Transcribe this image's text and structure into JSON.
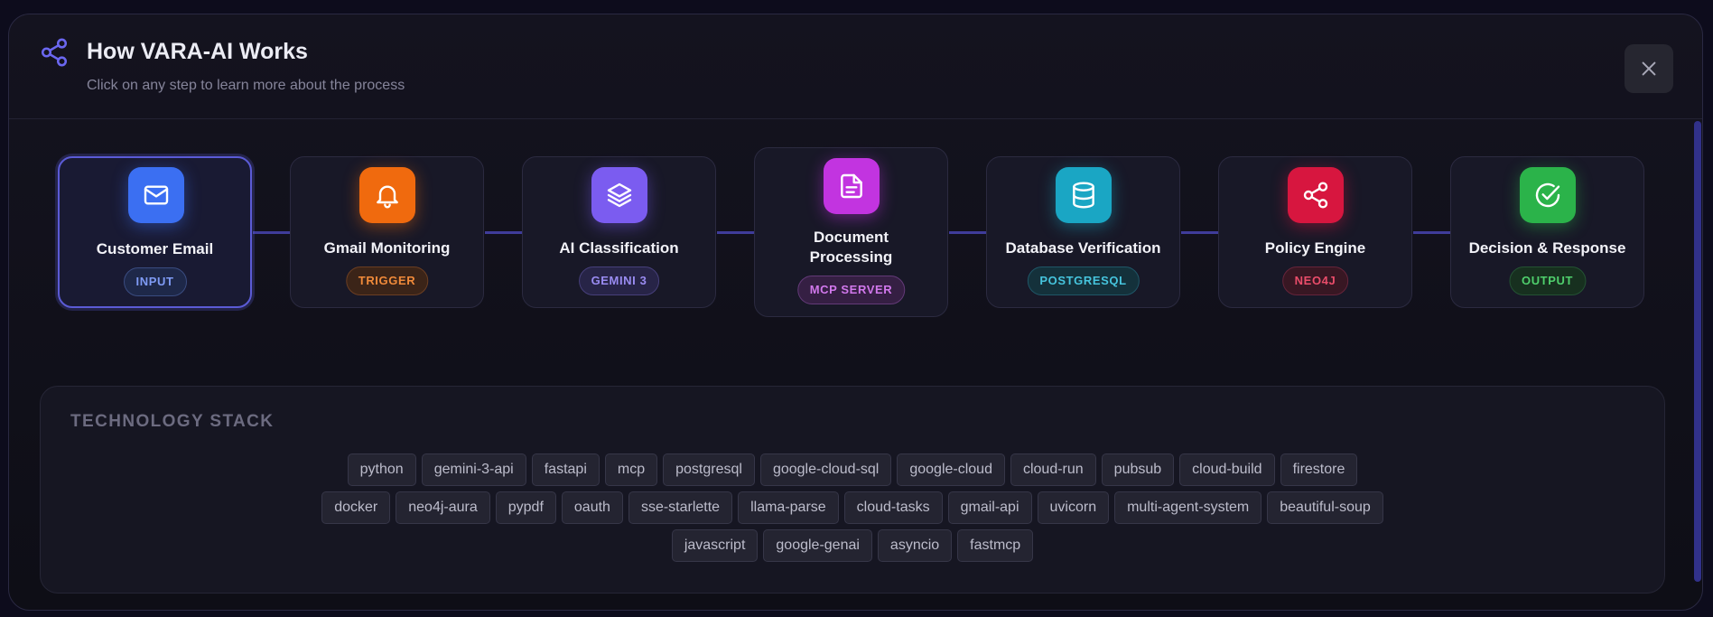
{
  "header": {
    "title": "How VARA-AI Works",
    "subtitle": "Click on any step to learn more about the process",
    "icon": "share-icon",
    "close_icon": "close-icon"
  },
  "steps": [
    {
      "title": "Customer Email",
      "tag": "INPUT",
      "icon": "mail-icon",
      "icon_color": "#3b6ff2",
      "tag_color": "#7f9bf5",
      "tag_bg": "#1e2849",
      "tag_border": "#3a4c80",
      "active": true
    },
    {
      "title": "Gmail Monitoring",
      "tag": "TRIGGER",
      "icon": "bell-icon",
      "icon_color": "#f06a0e",
      "tag_color": "#f08a3a",
      "tag_bg": "#3b2418",
      "tag_border": "#6b3e22",
      "active": false
    },
    {
      "title": "AI Classification",
      "tag": "GEMINI 3",
      "icon": "layers-icon",
      "icon_color": "#7b5cf0",
      "tag_color": "#9a8cf2",
      "tag_bg": "#272447",
      "tag_border": "#463f7a",
      "active": false
    },
    {
      "title": "Document Processing",
      "tag": "MCP SERVER",
      "icon": "document-icon",
      "icon_color": "#c234e0",
      "tag_color": "#d178ec",
      "tag_bg": "#351f43",
      "tag_border": "#633a78",
      "active": false
    },
    {
      "title": "Database Verification",
      "tag": "POSTGRESQL",
      "icon": "database-icon",
      "icon_color": "#1aa6c4",
      "tag_color": "#46c4dd",
      "tag_bg": "#14313b",
      "tag_border": "#1f5667",
      "active": false
    },
    {
      "title": "Policy Engine",
      "tag": "NEO4J",
      "icon": "share-icon",
      "icon_color": "#d7163f",
      "tag_color": "#ea4d6a",
      "tag_bg": "#381723",
      "tag_border": "#66243a",
      "active": false
    },
    {
      "title": "Decision & Response",
      "tag": "OUTPUT",
      "icon": "check-circle-icon",
      "icon_color": "#2bb34a",
      "tag_color": "#4fcf6c",
      "tag_bg": "#17301f",
      "tag_border": "#245233",
      "active": false
    }
  ],
  "tech_stack": {
    "title": "TECHNOLOGY STACK",
    "rows": [
      [
        "python",
        "gemini-3-api",
        "fastapi",
        "mcp",
        "postgresql",
        "google-cloud-sql",
        "google-cloud",
        "cloud-run",
        "pubsub",
        "cloud-build",
        "firestore"
      ],
      [
        "docker",
        "neo4j-aura",
        "pypdf",
        "oauth",
        "sse-starlette",
        "llama-parse",
        "cloud-tasks",
        "gmail-api",
        "uvicorn",
        "multi-agent-system",
        "beautiful-soup"
      ],
      [
        "javascript",
        "google-genai",
        "asyncio",
        "fastmcp"
      ]
    ]
  },
  "colors": {
    "accent": "#5b5bd6",
    "connector": "#3f3c9a"
  }
}
